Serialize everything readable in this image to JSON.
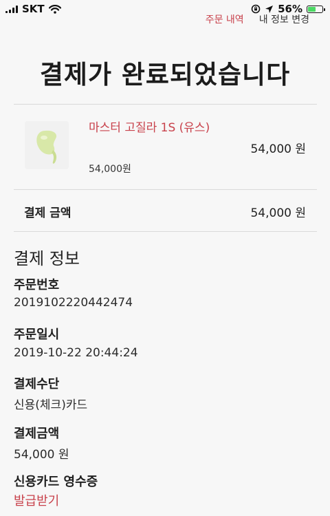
{
  "status_bar": {
    "carrier": "SKT",
    "battery_percent": "56%",
    "battery_level": 0.56,
    "icons": [
      "signal-icon",
      "wifi-icon",
      "rotation-lock-icon",
      "location-icon",
      "battery-icon"
    ]
  },
  "nav": {
    "order_history": "주문 내역",
    "profile_edit": "내 정보 변경"
  },
  "page_title": "결제가 완료되었습니다",
  "product": {
    "name": "마스터 고질라 1S (유스)",
    "unit_price": "54,000원",
    "total": "54,000 원",
    "image": "green-product-image"
  },
  "payment_summary": {
    "label": "결제 금액",
    "value": "54,000 원"
  },
  "payment_info": {
    "section_title": "결제 정보",
    "order_number_label": "주문번호",
    "order_number": "2019102220442474",
    "order_datetime_label": "주문일시",
    "order_datetime": "2019-10-22 20:44:24",
    "payment_method_label": "결제수단",
    "payment_method": "신용(체크)카드",
    "payment_amount_label": "결제금액",
    "payment_amount": "54,000 원",
    "receipt_label": "신용카드 영수증",
    "receipt_link": "발급받기"
  },
  "colors": {
    "accent": "#c8414b",
    "background": "#f7f7f7",
    "text": "#1f1f1f",
    "battery": "#4cd964"
  }
}
